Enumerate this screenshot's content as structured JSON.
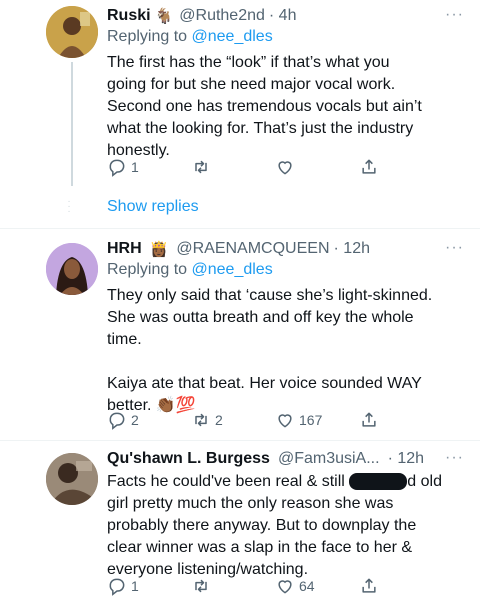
{
  "tweets": [
    {
      "name": "Ruski",
      "name_emoji": "🐐",
      "handle": "@Ruthe2nd",
      "time": "· 4h",
      "more": "···",
      "replying_prefix": "Replying to ",
      "replying_to": "@nee_dles",
      "text_lines": [
        "The first has the “look” if that’s what you",
        "going for but she need major vocal work.",
        "Second one has tremendous vocals but ain’t",
        "what the looking for. That’s just the industry",
        "honestly."
      ],
      "reply_count": "1",
      "retweet_count": "",
      "like_count": "",
      "show_replies": "Show replies"
    },
    {
      "name": "HRH",
      "name_emoji": "👸🏾",
      "handle": "@RAENAMCQUEEN",
      "time": "· 12h",
      "more": "···",
      "replying_prefix": "Replying to ",
      "replying_to": "@nee_dles",
      "text_lines": [
        "They only said that ‘cause she’s light-skinned.",
        "She was outta breath and off key the whole",
        "time.",
        "",
        "Kaiya ate that beat. Her voice sounded WAY",
        "better. 👏🏾💯"
      ],
      "reply_count": "2",
      "retweet_count": "2",
      "like_count": "167"
    },
    {
      "name": "Qu'shawn L. Burgess",
      "handle": "@Fam3usiA...",
      "time": "· 12h",
      "more": "···",
      "text_line1_before": "Facts he could've been real & still ",
      "text_line1_after": "d old",
      "text_lines": [
        "girl pretty much the only reason she was",
        "probably there anyway. But to downplay the",
        "clear winner was a slap in the face to her &",
        "everyone listening/watching."
      ],
      "reply_count": "1",
      "retweet_count": "",
      "like_count": "64"
    }
  ],
  "colors": {
    "link": "#1d9bf0",
    "muted": "#536471",
    "text": "#0f1419"
  }
}
